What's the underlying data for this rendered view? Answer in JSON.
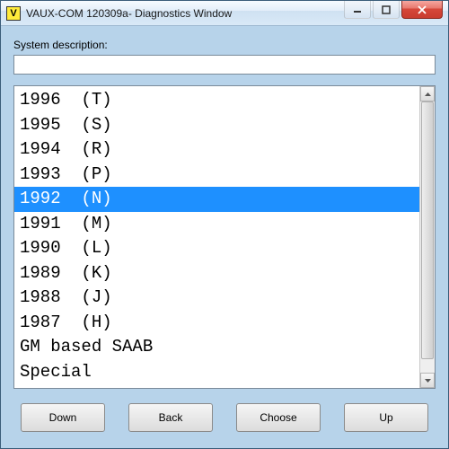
{
  "window": {
    "title": "VAUX-COM 120309a- Diagnostics Window",
    "icon_letter": "V"
  },
  "field": {
    "label": "System description:",
    "value": ""
  },
  "list": {
    "selected_index": 4,
    "items": [
      "1996  (T)",
      "1995  (S)",
      "1994  (R)",
      "1993  (P)",
      "1992  (N)",
      "1991  (M)",
      "1990  (L)",
      "1989  (K)",
      "1988  (J)",
      "1987  (H)",
      "GM based SAAB",
      "Special"
    ]
  },
  "buttons": {
    "down": "Down",
    "back": "Back",
    "choose": "Choose",
    "up": "Up"
  }
}
